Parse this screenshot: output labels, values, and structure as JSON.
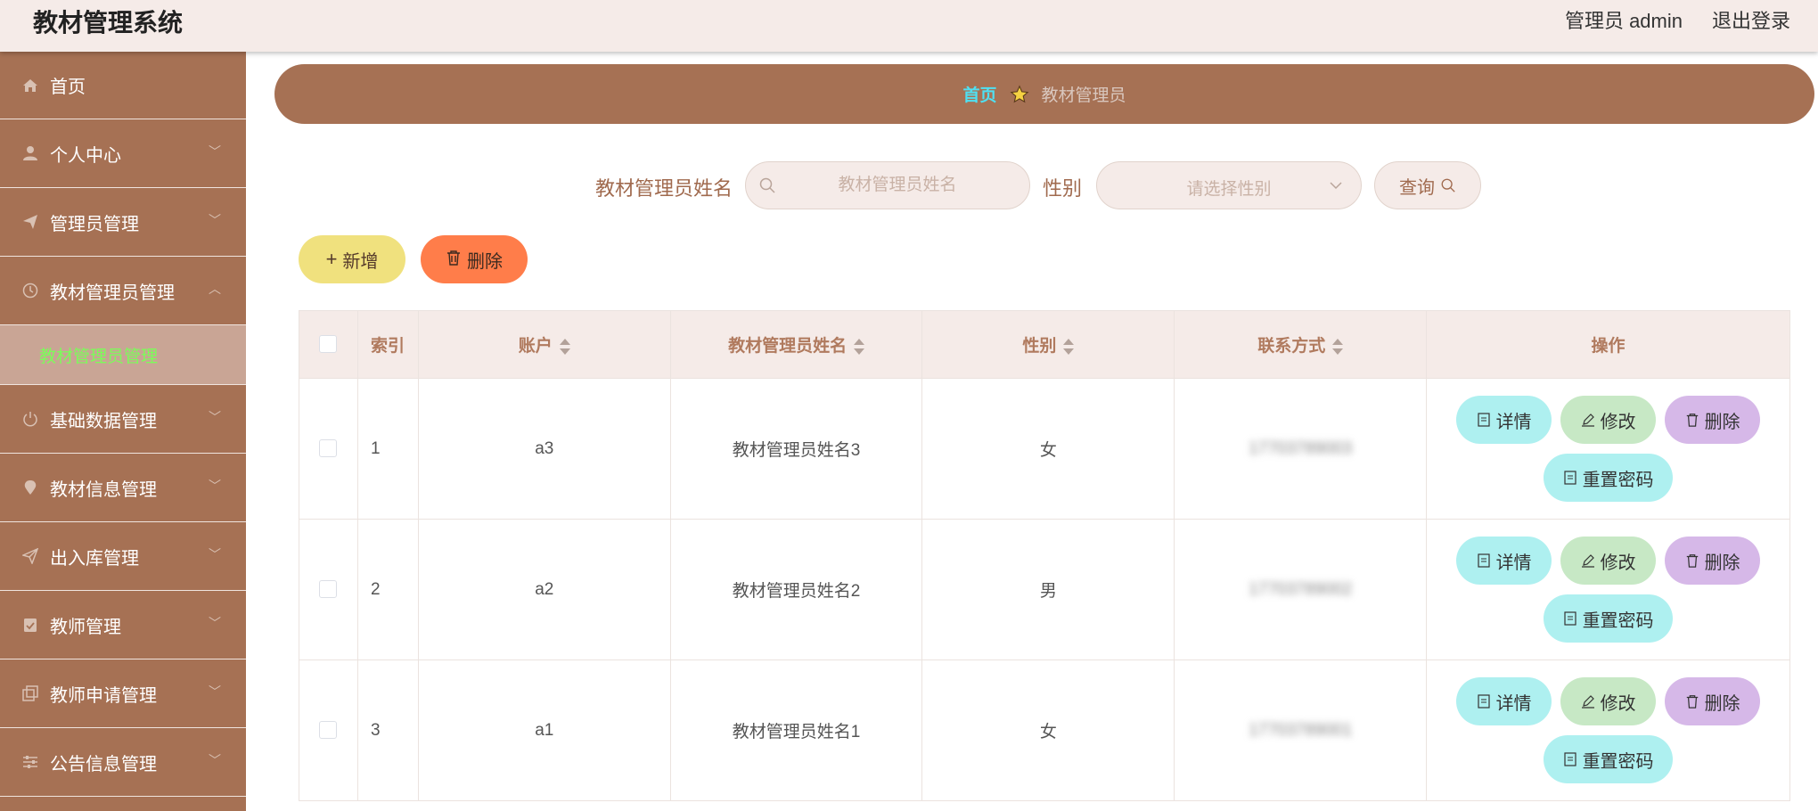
{
  "header": {
    "title": "教材管理系统",
    "user": "管理员 admin",
    "logout": "退出登录"
  },
  "sidebar": {
    "items": [
      {
        "label": "首页"
      },
      {
        "label": "个人中心"
      },
      {
        "label": "管理员管理"
      },
      {
        "label": "教材管理员管理"
      },
      {
        "label": "基础数据管理"
      },
      {
        "label": "教材信息管理"
      },
      {
        "label": "出入库管理"
      },
      {
        "label": "教师管理"
      },
      {
        "label": "教师申请管理"
      },
      {
        "label": "公告信息管理"
      }
    ],
    "active_sub": "教材管理员管理"
  },
  "breadcrumb": {
    "home": "首页",
    "current": "教材管理员"
  },
  "search": {
    "name_label": "教材管理员姓名",
    "name_placeholder": "教材管理员姓名",
    "gender_label": "性别",
    "gender_placeholder": "请选择性别",
    "query_label": "查询"
  },
  "actions": {
    "add": "新增",
    "delete": "删除"
  },
  "table": {
    "columns": [
      "索引",
      "账户",
      "教材管理员姓名",
      "性别",
      "联系方式",
      "操作"
    ],
    "rows": [
      {
        "index": "1",
        "account": "a3",
        "name": "教材管理员姓名3",
        "gender": "女",
        "contact": "17703789003"
      },
      {
        "index": "2",
        "account": "a2",
        "name": "教材管理员姓名2",
        "gender": "男",
        "contact": "17703789002"
      },
      {
        "index": "3",
        "account": "a1",
        "name": "教材管理员姓名1",
        "gender": "女",
        "contact": "17703789001"
      }
    ],
    "row_actions": {
      "detail": "详情",
      "edit": "修改",
      "delete": "删除",
      "reset": "重置密码"
    }
  },
  "colors": {
    "sidebar_bg": "#a67154",
    "header_bg": "#f5ebe8",
    "breadcrumb_home": "#4fe0f2",
    "active_submenu_text": "#7cfc5a",
    "add_button": "#f0e17e",
    "delete_button": "#ff7d4a"
  },
  "icons": {
    "menu": [
      "home-icon",
      "user-icon",
      "send-icon",
      "clock-icon",
      "power-icon",
      "location-icon",
      "paper-plane-icon",
      "clipboard-icon",
      "copy-icon",
      "sliders-icon"
    ]
  }
}
